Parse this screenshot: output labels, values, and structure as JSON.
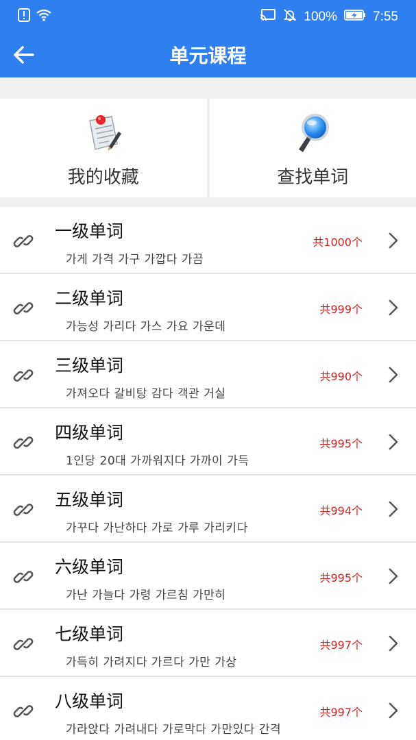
{
  "status": {
    "battery_percent": "100%",
    "time": "7:55"
  },
  "header": {
    "title": "单元课程"
  },
  "cards": [
    {
      "label": "我的收藏",
      "icon": "document-pin-icon"
    },
    {
      "label": "查找单词",
      "icon": "magnifier-icon"
    }
  ],
  "levels": [
    {
      "title": "一级单词",
      "words": "가게  가격  가구  가깝다  가끔",
      "count": "共1000个"
    },
    {
      "title": "二级单词",
      "words": "가능성  가리다  가스  가요  가운데",
      "count": "共999个"
    },
    {
      "title": "三级单词",
      "words": "가져오다  갈비탕  감다  객관  거실",
      "count": "共990个"
    },
    {
      "title": "四级单词",
      "words": "1인당  20대  가까워지다  가까이  가득",
      "count": "共995个"
    },
    {
      "title": "五级单词",
      "words": "가꾸다  가난하다  가로  가루  가리키다",
      "count": "共994个"
    },
    {
      "title": "六级单词",
      "words": "가난  가늘다  가령  가르침  가만히",
      "count": "共995个"
    },
    {
      "title": "七级单词",
      "words": "가득히  가려지다  가르다  가만  가상",
      "count": "共997个"
    },
    {
      "title": "八级单词",
      "words": "가라앉다  가려내다  가로막다  가만있다  간격",
      "count": "共997个"
    }
  ],
  "colors": {
    "header_bg": "#2f7ff0",
    "count_red": "#d0231f"
  }
}
